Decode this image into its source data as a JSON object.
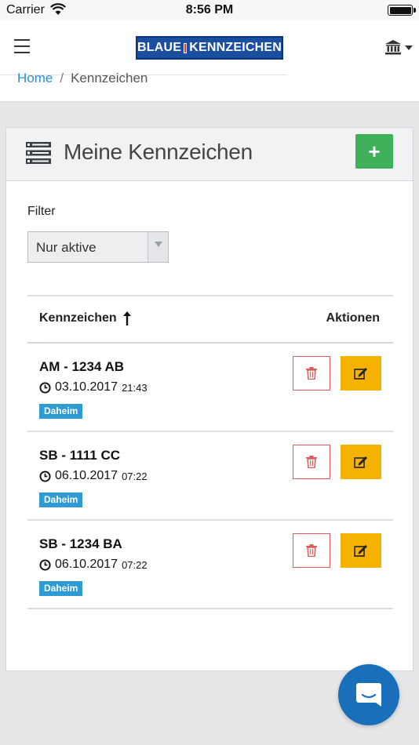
{
  "status_bar": {
    "carrier": "Carrier",
    "time": "8:56 PM"
  },
  "header": {
    "logo_left": "BLAUE",
    "logo_right": "KENNZEICHEN",
    "breadcrumb": {
      "home": "Home",
      "separator": "/",
      "current": "Kennzeichen"
    }
  },
  "panel": {
    "title": "Meine Kennzeichen",
    "add_label": "+",
    "filter_label": "Filter",
    "filter_selected": "Nur aktive"
  },
  "table": {
    "col_plate": "Kennzeichen",
    "col_actions": "Aktionen",
    "rows": [
      {
        "plate": "AM - 1234 AB",
        "date": "03.10.2017",
        "time": "21:43",
        "badge": "Daheim"
      },
      {
        "plate": "SB - 1111 CC",
        "date": "06.10.2017",
        "time": "07:22",
        "badge": "Daheim"
      },
      {
        "plate": "SB - 1234 BA",
        "date": "06.10.2017",
        "time": "07:22",
        "badge": "Daheim"
      }
    ]
  },
  "colors": {
    "accent_green": "#40b15b",
    "danger_red": "#e05a5a",
    "edit_yellow": "#f6b200",
    "badge_blue": "#2f9bd2",
    "link_blue": "#2a8fd4",
    "chat_blue": "#1a6fba"
  },
  "icons": [
    "wifi-icon",
    "battery-icon",
    "menu-icon",
    "bank-icon",
    "chevron-down-icon",
    "list-icon",
    "sort-up-icon",
    "clock-icon",
    "trash-icon",
    "edit-icon",
    "chat-icon"
  ]
}
